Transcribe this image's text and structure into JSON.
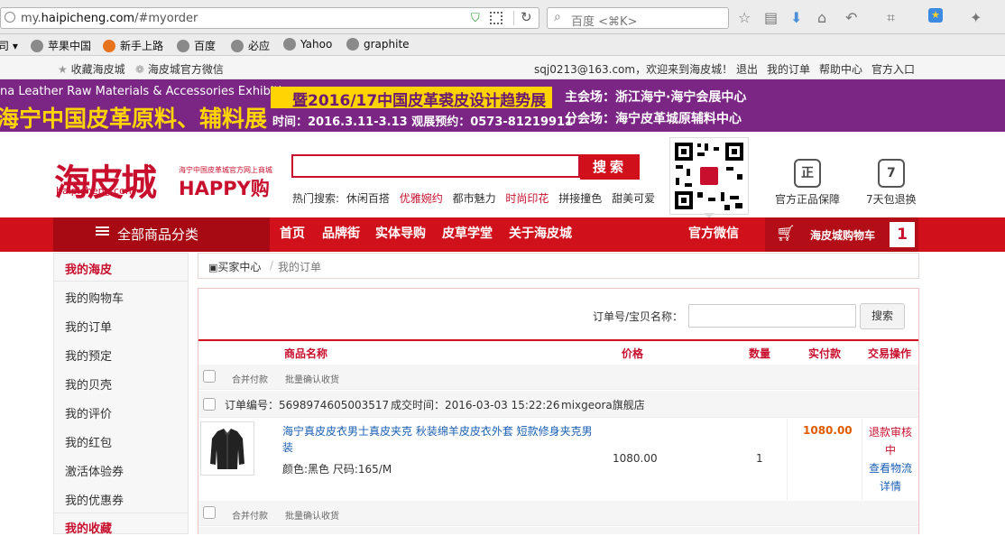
{
  "browser": {
    "url_prefix": "my.",
    "url_domain": "haipicheng.com",
    "url_path": "/#myorder",
    "search_placeholder": "百度 <⌘K>",
    "bookmarks": [
      "苹果中国",
      "新手上路",
      "百度",
      "必应",
      "Yahoo",
      "graphite"
    ]
  },
  "topbar": {
    "fav": "收藏海皮城",
    "wechat": "海皮城官方微信",
    "welcome": "sqj0213@163.com，欢迎来到海皮城！",
    "links": [
      "退出",
      "我的订单",
      "帮助中心",
      "官方入口"
    ]
  },
  "banner": {
    "en_title": "na Leather Raw Materials & Accessories Exhibition",
    "cn_title": "海宁中国皮革原料、辅料展",
    "time": "时间：2016.3.11-3.13  观展预约：0573-81219911",
    "yellow": "暨2016/17中国皮革裘皮设计趋势展",
    "venue1": "主会场：浙江海宁·海宁会展中心",
    "venue2": "分会场：海宁皮革城原辅料中心"
  },
  "header": {
    "logo": "海皮城",
    "logo_sub": "海宁中国皮革城官方网上商城",
    "logo_happy": "HAPPY购",
    "logo_url": "haipicheng.com",
    "search_button": "搜索",
    "hot_label": "热门搜索:",
    "hot_terms": [
      "休闲百搭",
      "优雅婉约",
      "都市魅力",
      "时尚印花",
      "拼接撞色",
      "甜美可爱"
    ],
    "feature1": "官方正品保障",
    "feature2": "7天包退换"
  },
  "nav": {
    "category": "全部商品分类",
    "items": [
      "首页",
      "品牌街",
      "实体导购",
      "皮草学堂",
      "关于海皮城"
    ],
    "wechat": "官方微信",
    "cart": "海皮城购物车",
    "cart_count": "1"
  },
  "sidebar": {
    "head": "我的海皮",
    "items": [
      "我的购物车",
      "我的订单",
      "我的预定",
      "我的贝壳",
      "我的评价",
      "我的红包",
      "激活体验券",
      "我的优惠券"
    ],
    "head2": "我的收藏"
  },
  "breadcrumb": {
    "root": "买家中心",
    "sep": "/",
    "current": "我的订单"
  },
  "query": {
    "label": "订单号/宝贝名称：",
    "button": "搜索"
  },
  "table": {
    "headers": [
      "商品名称",
      "价格",
      "数量",
      "实付款",
      "交易操作"
    ],
    "bulk_pay": "合并付款",
    "bulk_confirm": "批量确认收货"
  },
  "order": {
    "number": "订单编号：5698974605003517",
    "time": "成交时间：2016-03-03 15:22:26",
    "shop": "mixgeora旗舰店",
    "title": "海宁真皮皮衣男士真皮夹克 秋装绵羊皮皮衣外套 短款修身夹克男装",
    "spec": "颜色:黑色 尺码:165/M",
    "price": "1080.00",
    "qty": "1",
    "paid": "1080.00",
    "status": "退款审核中",
    "logistics": "查看物流详情"
  }
}
